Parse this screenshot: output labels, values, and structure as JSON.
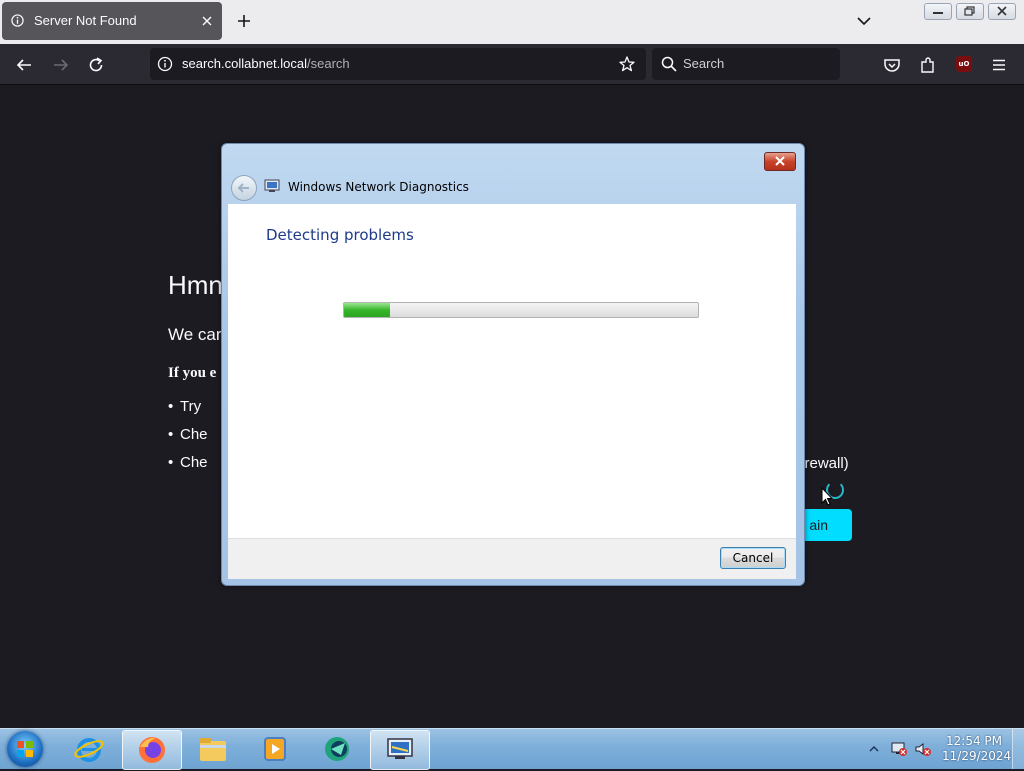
{
  "browser": {
    "tab_title": "Server Not Found",
    "url_host": "search.collabnet.local",
    "url_path": "/search",
    "search_placeholder": "Search",
    "ublock_label": "uO"
  },
  "error_page": {
    "title": "Hmn",
    "subtitle": "We car",
    "lead": "If you e",
    "items": [
      "Try",
      "Che",
      "Che"
    ],
    "tail": "firewall)",
    "try_again": "ain"
  },
  "dialog": {
    "title": "Windows Network Diagnostics",
    "heading": "Detecting problems",
    "progress": 0.13,
    "cancel_label": "Cancel"
  },
  "taskbar": {
    "time": "12:54 PM",
    "date": "11/29/2024",
    "items": [
      "internet-explorer",
      "firefox",
      "file-explorer",
      "media-player",
      "app",
      "network-diagnostics"
    ]
  },
  "colors": {
    "page_bg": "#1c1b22",
    "accent": "#00ddff",
    "progress_green": "#37b52b"
  }
}
